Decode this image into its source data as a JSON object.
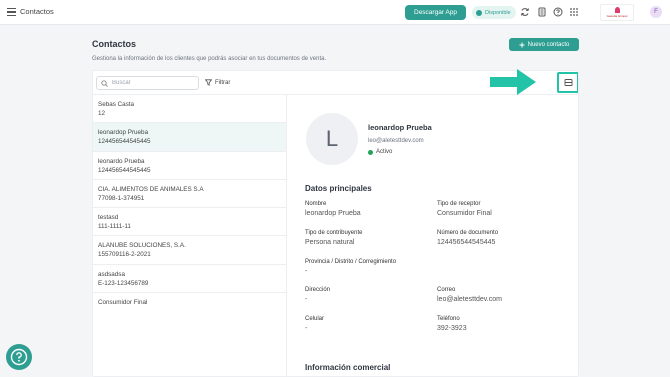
{
  "topbar": {
    "app_title": "Contactos",
    "download_label": "Descargar App",
    "status_label": "Disponible",
    "company_logo_text": "Gacetta Gimpel",
    "avatar_initial": "F"
  },
  "page": {
    "title": "Contactos",
    "subtitle": "Gestiona la información de los clientes que podrás asociar en tus documentos de venta.",
    "new_contact_label": "Nuevo contacto"
  },
  "toolbar": {
    "search_placeholder": "Buscar",
    "filter_label": "Filtrar"
  },
  "contacts": [
    {
      "name": "Sebas Casta",
      "id": "12"
    },
    {
      "name": "leonardop Prueba",
      "id": "124456544545445"
    },
    {
      "name": "leonardo Prueba",
      "id": "124456544545445"
    },
    {
      "name": "CIA. ALIMENTOS DE ANIMALES S.A",
      "id": "77098-1-374951"
    },
    {
      "name": "testasd",
      "id": "111-1111-11"
    },
    {
      "name": "ALANUBE SOLUCIONES, S.A.",
      "id": "155709116-2-2021"
    },
    {
      "name": "asdsadsa",
      "id": "E-123-123456789"
    },
    {
      "name": "Consumidor Final",
      "id": ""
    }
  ],
  "detail": {
    "initial": "L",
    "name": "leonardop Prueba",
    "email": "leo@aletesttdev.com",
    "status": "Activo",
    "section_main": "Datos principales",
    "section_commercial": "Información comercial",
    "fields": {
      "nombre_label": "Nombre",
      "nombre_value": "leonardop Prueba",
      "tipo_receptor_label": "Tipo de receptor",
      "tipo_receptor_value": "Consumidor Final",
      "tipo_contribuyente_label": "Tipo de contribuyente",
      "tipo_contribuyente_value": "Persona natural",
      "numero_documento_label": "Número de documento",
      "numero_documento_value": "124456544545445",
      "provincia_label": "Provincia / Distrito / Corregimiento",
      "provincia_value": "-",
      "direccion_label": "Dirección",
      "direccion_value": "-",
      "correo_label": "Correo",
      "correo_value": "leo@aletesttdev.com",
      "celular_label": "Celular",
      "celular_value": "-",
      "telefono_label": "Teléfono",
      "telefono_value": "392-3923"
    }
  },
  "colors": {
    "accent": "#2e9e93",
    "highlight": "#22c3a6",
    "active_dot": "#22a35a"
  }
}
